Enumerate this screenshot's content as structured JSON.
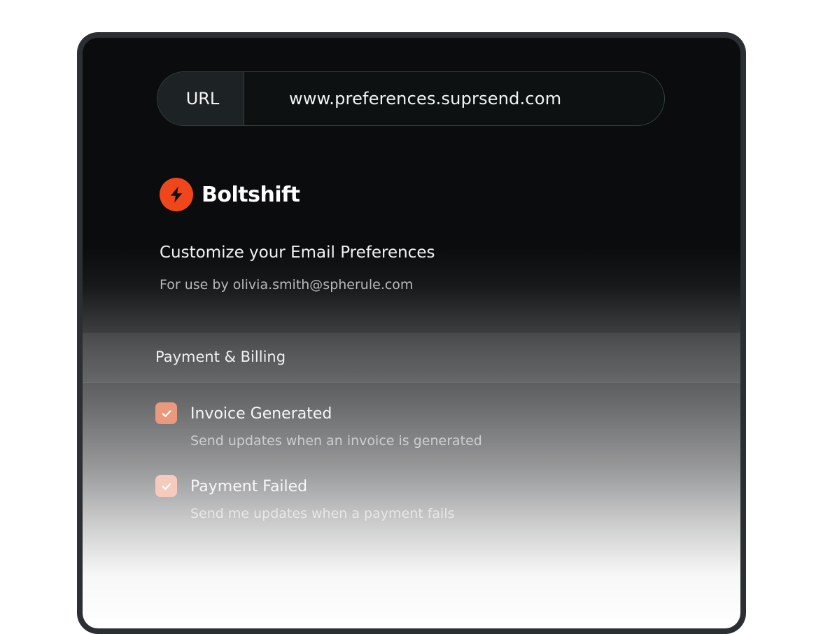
{
  "url_bar": {
    "label": "URL",
    "value": "www.preferences.suprsend.com"
  },
  "brand": {
    "name": "Boltshift",
    "icon": "lightning-bolt-icon",
    "accent_color": "#f0461c"
  },
  "page": {
    "heading": "Customize your Email Preferences",
    "subheading": "For use by olivia.smith@spherule.com"
  },
  "section": {
    "title": "Payment & Billing",
    "preferences": [
      {
        "title": "Invoice Generated",
        "description": "Send updates when an invoice is generated",
        "checked": true,
        "checkbox_color": "#e99a7e"
      },
      {
        "title": "Payment Failed",
        "description": "Send me updates when a payment fails",
        "checked": true,
        "checkbox_color": "#f6cbbd"
      }
    ]
  }
}
